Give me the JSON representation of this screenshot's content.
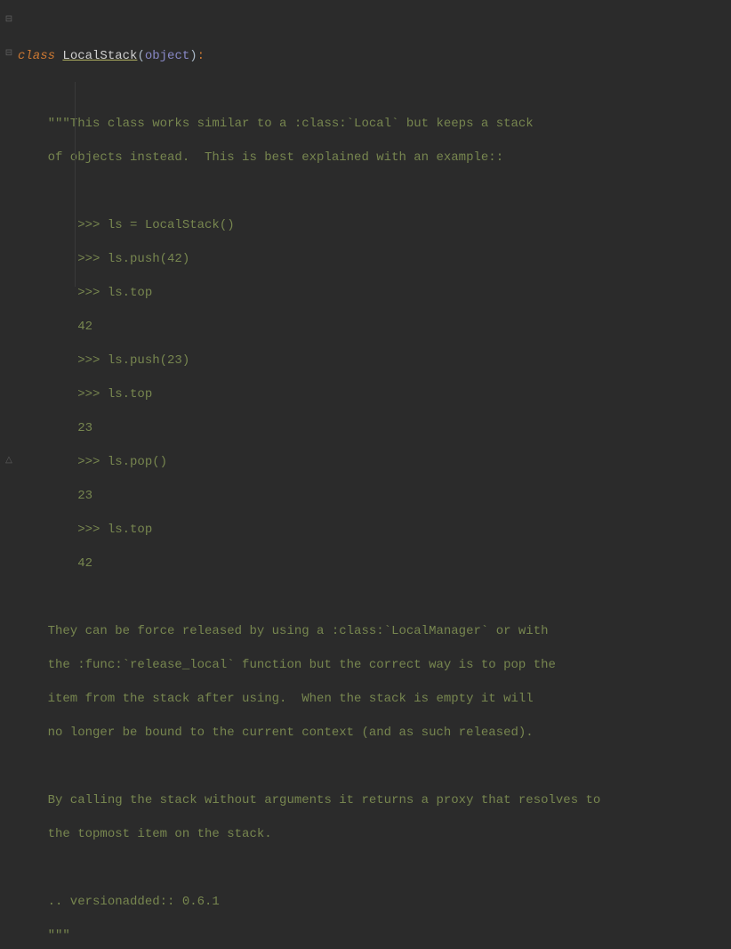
{
  "code": {
    "keyword_class": "class ",
    "class_name": "LocalStack",
    "open_paren": "(",
    "base": "object",
    "close_paren": ")",
    "colon": ":",
    "doc_open": "    \"\"\"This class works similar to a :class:`Local` but keeps a stack",
    "doc_l2": "    of objects instead.  This is best explained with an example::",
    "doc_ex1": "        >>> ls = LocalStack()",
    "doc_ex2": "        >>> ls.push(42)",
    "doc_ex3": "        >>> ls.top",
    "doc_ex4": "        42",
    "doc_ex5": "        >>> ls.push(23)",
    "doc_ex6": "        >>> ls.top",
    "doc_ex7": "        23",
    "doc_ex8": "        >>> ls.pop()",
    "doc_ex9": "        23",
    "doc_ex10": "        >>> ls.top",
    "doc_ex11": "        42",
    "doc_p2a": "    They can be force released by using a :class:`LocalManager` or with",
    "doc_p2b": "    the :func:`release_local` function but the correct way is to pop the",
    "doc_p2c": "    item from the stack after using.  When the stack is empty it will",
    "doc_p2d": "    no longer be bound to the current context (and as such released).",
    "doc_p3a": "    By calling the stack without arguments it returns a proxy that resolves to",
    "doc_p3b": "    the topmost item on the stack.",
    "doc_ver": "    .. versionadded:: 0.6.1",
    "doc_close": "    \"\"\""
  },
  "gutter": {
    "fold_open": "⊟",
    "fold_end": "△"
  }
}
